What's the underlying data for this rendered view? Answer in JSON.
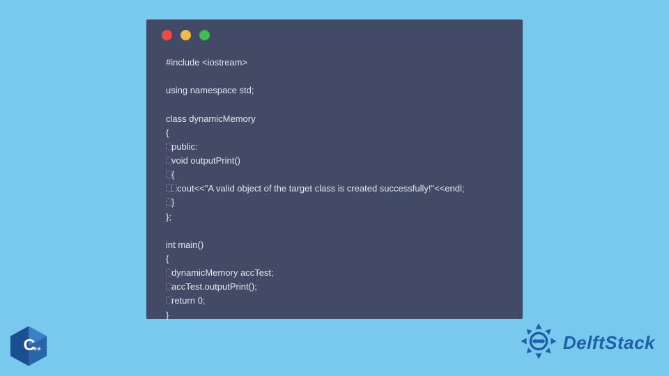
{
  "code": {
    "lines": [
      {
        "indent": 0,
        "text": "#include <iostream>"
      },
      {
        "blank": true
      },
      {
        "indent": 0,
        "text": "using namespace std;"
      },
      {
        "blank": true
      },
      {
        "indent": 0,
        "text": "class dynamicMemory"
      },
      {
        "indent": 0,
        "text": "{"
      },
      {
        "indent": 1,
        "text": "public:"
      },
      {
        "indent": 1,
        "text": "void outputPrint()"
      },
      {
        "indent": 1,
        "text": "{"
      },
      {
        "indent": 2,
        "text": "cout<<\"A valid object of the target class is created successfully!\"<<endl;"
      },
      {
        "indent": 1,
        "text": "}"
      },
      {
        "indent": 0,
        "text": "};"
      },
      {
        "blank": true
      },
      {
        "indent": 0,
        "text": "int main()"
      },
      {
        "indent": 0,
        "text": "{"
      },
      {
        "indent": 1,
        "text": "dynamicMemory accTest;"
      },
      {
        "indent": 1,
        "text": "accTest.outputPrint();"
      },
      {
        "indent": 1,
        "text": "return 0;"
      },
      {
        "indent": 0,
        "text": "}"
      }
    ]
  },
  "cpp_badge": {
    "label": "C",
    "sub": "++"
  },
  "brand": {
    "text": "DelftStack"
  }
}
